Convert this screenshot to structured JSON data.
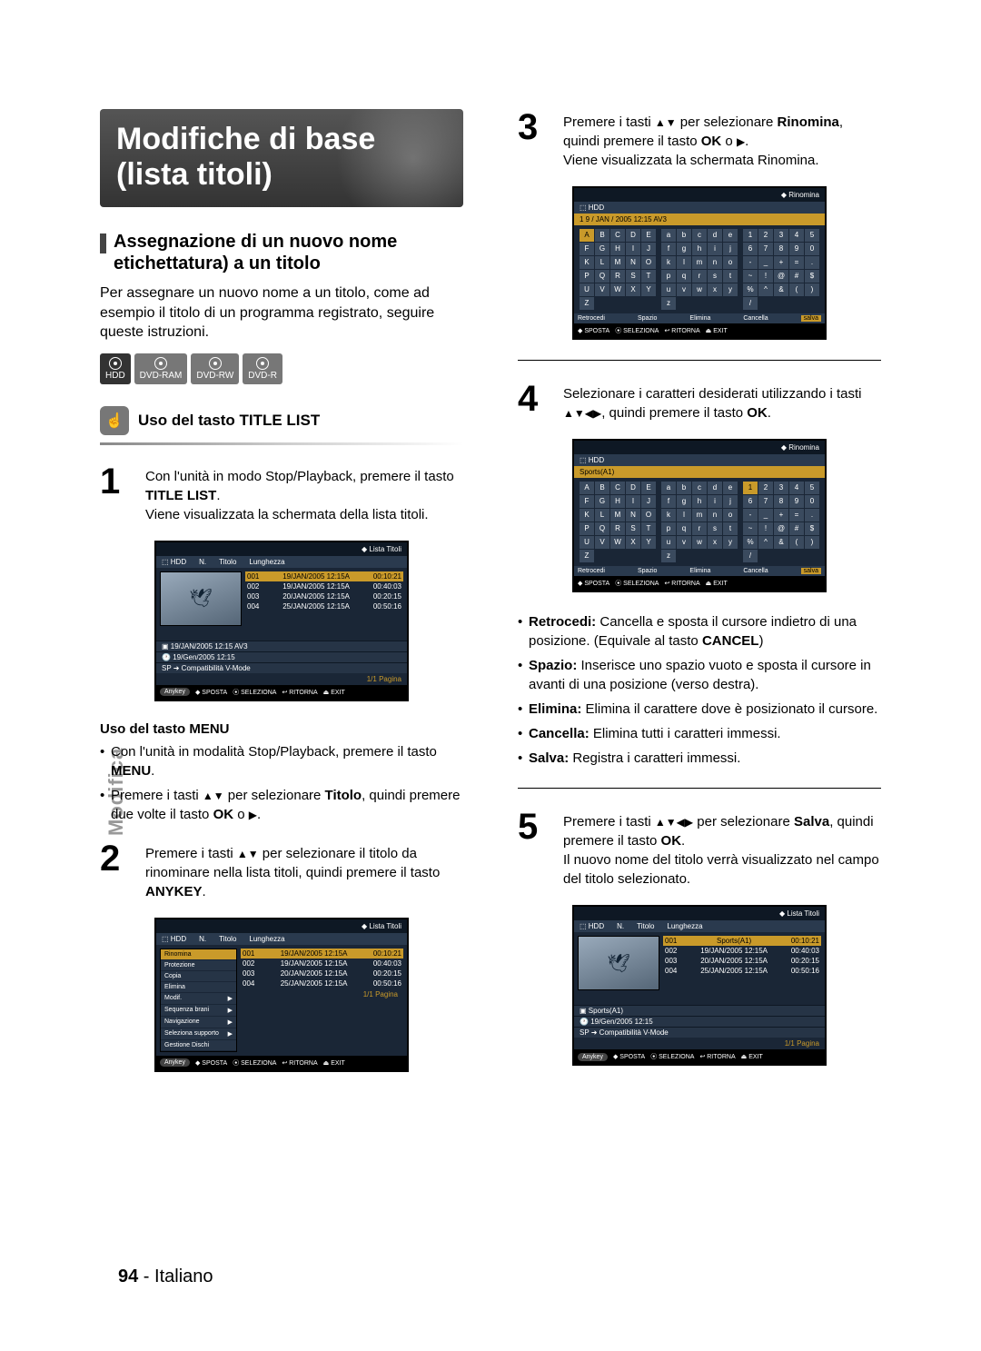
{
  "page": {
    "number": "94",
    "lang": "Italiano",
    "side_tab": "Modifica"
  },
  "title": "Modifiche di base (lista titoli)",
  "section": {
    "heading": "Assegnazione di un nuovo nome etichettatura) a un titolo",
    "intro": "Per assegnare un nuovo nome a un titolo, come ad esempio il titolo di un programma registrato, seguire queste istruzioni."
  },
  "media": [
    "HDD",
    "DVD-RAM",
    "DVD-RW",
    "DVD-R"
  ],
  "subsection": {
    "heading": "Uso del tasto TITLE LIST"
  },
  "steps": {
    "s1": {
      "num": "1",
      "text_a": "Con l'unità in modo Stop/Playback, premere il tasto ",
      "bold_a": "TITLE LIST",
      "text_b": ".\nViene visualizzata la schermata della lista titoli."
    },
    "menu_head": "Uso del tasto MENU",
    "menu_b1a": "Con l'unità in modalità Stop/Playback, premere il tasto ",
    "menu_b1b": "MENU",
    "menu_b1c": ".",
    "menu_b2a": "Premere i tasti ",
    "menu_b2b": " per selezionare ",
    "menu_b2c": "Titolo",
    "menu_b2d": ", quindi premere due volte il tasto ",
    "menu_b2e": "OK",
    "menu_b2f": " o ",
    "s2": {
      "num": "2",
      "text_a": "Premere i tasti ",
      "text_b": " per selezionare il titolo da rinominare nella lista titoli, quindi premere il tasto ",
      "bold_a": "ANYKEY",
      "text_c": "."
    },
    "s3": {
      "num": "3",
      "text_a": "Premere i tasti ",
      "text_b": " per selezionare ",
      "bold_a": "Rinomina",
      "text_c": ", quindi premere il tasto ",
      "bold_b": "OK",
      "text_d": " o ",
      "text_e": ".\nViene visualizzata la schermata Rinomina."
    },
    "s4": {
      "num": "4",
      "text_a": "Selezionare i caratteri desiderati utilizzando i tasti ",
      "text_b": ", quindi premere il tasto ",
      "bold_a": "OK",
      "text_c": "."
    },
    "s5": {
      "num": "5",
      "text_a": "Premere i tasti ",
      "text_b": " per selezionare ",
      "bold_a": "Salva",
      "text_c": ", quindi premere il tasto ",
      "bold_b": "OK",
      "text_d": ".\nIl nuovo nome del titolo verrà visualizzato nel campo del titolo selezionato."
    }
  },
  "defs": {
    "retrocedi_l": "Retrocedi:",
    "retrocedi": " Cancella e sposta il cursore indietro di una posizione. (Equivale al tasto ",
    "retrocedi_b": "CANCEL",
    "retrocedi_end": ")",
    "spazio_l": "Spazio:",
    "spazio": " Inserisce uno spazio vuoto e sposta il cursore in avanti di una posizione (verso destra).",
    "elimina_l": "Elimina:",
    "elimina": " Elimina il carattere dove è posizionato il cursore.",
    "cancella_l": "Cancella:",
    "cancella": " Elimina tutti i caratteri immessi.",
    "salva_l": "Salva:",
    "salva": " Registra i caratteri immessi."
  },
  "osd": {
    "lista_titoli": "Lista Titoli",
    "rinomina": "Rinomina",
    "hdd": "HDD",
    "cols": {
      "n": "N.",
      "titolo": "Titolo",
      "lunghezza": "Lunghezza"
    },
    "rows": [
      {
        "n": "001",
        "t": "19/JAN/2005 12:15A",
        "d": "00:10:21"
      },
      {
        "n": "002",
        "t": "19/JAN/2005 12:15A",
        "d": "00:40:03"
      },
      {
        "n": "003",
        "t": "20/JAN/2005 12:15A",
        "d": "00:20:15"
      },
      {
        "n": "004",
        "t": "25/JAN/2005 12:15A",
        "d": "00:50:16"
      }
    ],
    "rows5": [
      {
        "n": "001",
        "t": "Sports(A1)",
        "d": "00:10:21"
      },
      {
        "n": "002",
        "t": "19/JAN/2005 12:15A",
        "d": "00:40:03"
      },
      {
        "n": "003",
        "t": "20/JAN/2005 12:15A",
        "d": "00:20:15"
      },
      {
        "n": "004",
        "t": "25/JAN/2005 12:15A",
        "d": "00:50:16"
      }
    ],
    "meta1": "19/JAN/2005 12:15 AV3",
    "meta1b": "Sports(A1)",
    "meta2": "19/Gen/2005 12:15",
    "meta3": "SP ➜ Compatibilità V-Mode",
    "pagina": "1/1 Pagina",
    "foot": {
      "anykey": "Anykey",
      "sposta": "SPOSTA",
      "seleziona": "SELEZIONA",
      "ritorna": "RITORNA",
      "exit": "EXIT"
    },
    "ctx": [
      "Rinomina",
      "Protezione",
      "Copia",
      "Elimina",
      "Modif.",
      "Sequenza brani",
      "Navigazione",
      "Seleziona supporto",
      "Gestione Dischi"
    ],
    "kbd_title": "1 9 / JAN / 2005 12:15 AV3",
    "kbd_title2": "Sports(A1)",
    "kbd_upper": [
      "A",
      "B",
      "C",
      "D",
      "E",
      "F",
      "G",
      "H",
      "I",
      "J",
      "K",
      "L",
      "M",
      "N",
      "O",
      "P",
      "Q",
      "R",
      "S",
      "T",
      "U",
      "V",
      "W",
      "X",
      "Y",
      "Z"
    ],
    "kbd_lower": [
      "a",
      "b",
      "c",
      "d",
      "e",
      "f",
      "g",
      "h",
      "i",
      "j",
      "k",
      "l",
      "m",
      "n",
      "o",
      "p",
      "q",
      "r",
      "s",
      "t",
      "u",
      "v",
      "w",
      "x",
      "y",
      "z"
    ],
    "kbd_num": [
      "1",
      "2",
      "3",
      "4",
      "5",
      "6",
      "7",
      "8",
      "9",
      "0",
      "-",
      "_",
      "+",
      "=",
      ".",
      "~",
      "!",
      "@",
      "#",
      "$",
      "%",
      "^",
      "&",
      "(",
      ")",
      "/"
    ],
    "kbd_actions": {
      "retrocedi": "Retrocedi",
      "spazio": "Spazio",
      "elimina": "Elimina",
      "cancella": "Cancella",
      "salva": "salva"
    }
  }
}
